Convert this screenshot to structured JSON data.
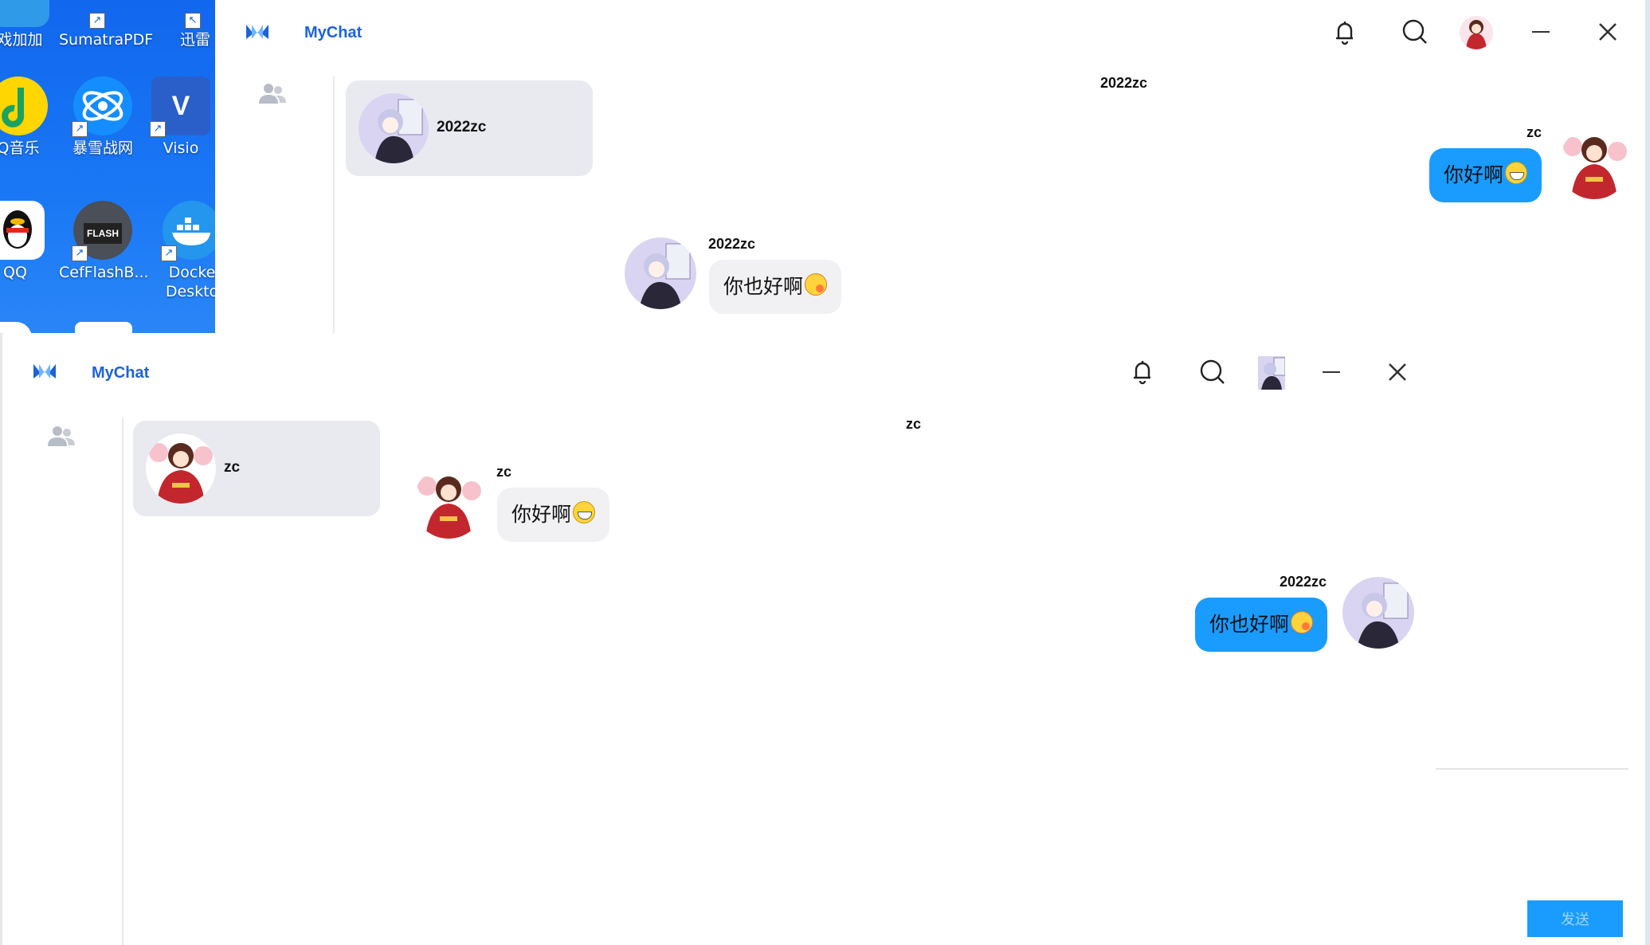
{
  "desktop": {
    "icons": [
      {
        "label": "戏加加"
      },
      {
        "label": "SumatraPDF"
      },
      {
        "label": "迅雷"
      },
      {
        "label": "Q音乐"
      },
      {
        "label": "暴雪战网"
      },
      {
        "label": "Visio"
      },
      {
        "label": "QQ"
      },
      {
        "label": "CefFlashB..."
      },
      {
        "label": "Docke\nDeskto"
      }
    ],
    "flash_badge": "FLASH",
    "visio_letter": "V"
  },
  "window1": {
    "app_name": "MyChat",
    "contact": {
      "name": "2022zc"
    },
    "chat_title": "2022zc",
    "messages": [
      {
        "sender": "zc",
        "text": "你好啊",
        "emoji": "grin-emoji",
        "direction": "out"
      },
      {
        "sender": "2022zc",
        "text": "你也好啊",
        "emoji": "hug-emoji",
        "direction": "in"
      }
    ]
  },
  "window2": {
    "app_name": "MyChat",
    "contact": {
      "name": "zc"
    },
    "chat_title": "zc",
    "messages": [
      {
        "sender": "zc",
        "text": "你好啊",
        "emoji": "grin-emoji",
        "direction": "in"
      },
      {
        "sender": "2022zc",
        "text": "你也好啊",
        "emoji": "hug-emoji",
        "direction": "out"
      }
    ],
    "send_label": "发送"
  },
  "colors": {
    "accent": "#1a9cff",
    "brand": "#1e62d8",
    "contact_bg": "#e8eaf0",
    "desktop": "#1167ee"
  }
}
